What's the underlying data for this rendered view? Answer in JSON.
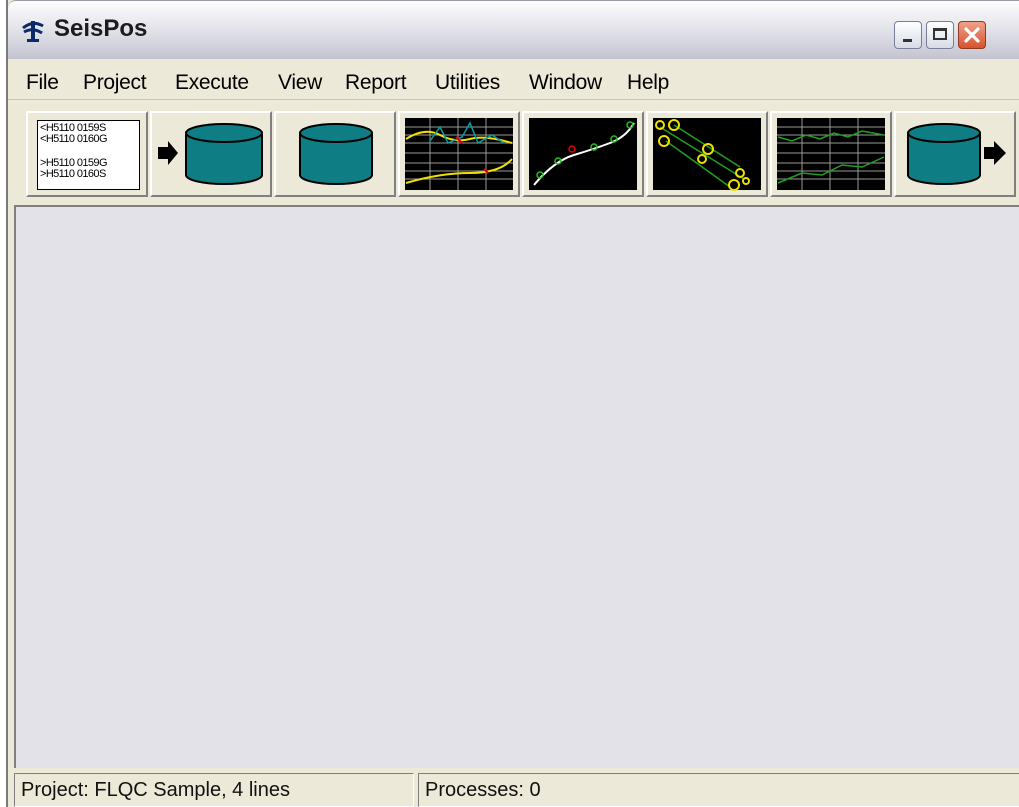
{
  "window": {
    "title": "SeisPos",
    "title_icon": "seispos-app-icon",
    "controls": {
      "minimize": "minimize-icon",
      "maximize": "maximize-icon",
      "close": "close-icon"
    }
  },
  "menu": {
    "items": [
      "File",
      "Project",
      "Execute",
      "View",
      "Report",
      "Utilities",
      "Window",
      "Help"
    ]
  },
  "toolbar": {
    "buttons": [
      {
        "icon": "header-list-icon",
        "lines": [
          "<H5110 0159S",
          "<H5110 0160G",
          ">H5110 0159G",
          ">H5110 0160S"
        ]
      },
      {
        "icon": "import-database-icon"
      },
      {
        "icon": "database-icon"
      },
      {
        "icon": "multi-trace-chart-icon"
      },
      {
        "icon": "curve-fit-plot-icon"
      },
      {
        "icon": "position-scatter-icon"
      },
      {
        "icon": "trace-grid-icon"
      },
      {
        "icon": "export-database-icon"
      }
    ]
  },
  "status": {
    "project": "Project: FLQC Sample, 4 lines",
    "processes": "Processes: 0"
  },
  "colors": {
    "db_teal": "#0e7e84",
    "titlebar": "#d6d6e0",
    "client": "#e3e2e8",
    "close_red": "#d8532d"
  }
}
